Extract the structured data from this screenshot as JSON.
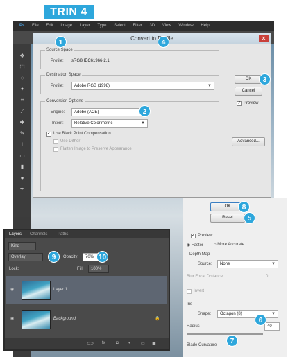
{
  "step_label": "TRIN 4",
  "badges": [
    "1",
    "2",
    "3",
    "4",
    "5",
    "6",
    "7",
    "8",
    "9",
    "10"
  ],
  "app": {
    "logo": "Ps",
    "menu": [
      "File",
      "Edit",
      "Image",
      "Layer",
      "Type",
      "Select",
      "Filter",
      "3D",
      "View",
      "Window",
      "Help"
    ]
  },
  "dialog": {
    "title": "Convert to Profile",
    "source_group": "Source Space",
    "source_label": "Profile:",
    "source_value": "sRGB IEC61966-2.1",
    "dest_group": "Destination Space",
    "dest_label": "Profile:",
    "dest_value": "Adobe RGB (1998)",
    "conv_group": "Conversion Options",
    "engine_label": "Engine:",
    "engine_value": "Adobe (ACE)",
    "intent_label": "Intent:",
    "intent_value": "Relative Colorimetric",
    "use_bpc": "Use Black Point Compensation",
    "use_dither": "Use Dither",
    "flatten": "Flatten Image to Preserve Appearance",
    "ok": "OK",
    "cancel": "Cancel",
    "preview": "Preview",
    "advanced": "Advanced..."
  },
  "blur_panel": {
    "ok": "OK",
    "reset": "Reset",
    "preview": "Preview",
    "faster": "Faster",
    "more_accurate": "More Accurate",
    "depth_map": "Depth Map",
    "source_label": "Source:",
    "source_value": "None",
    "blur_focal": "Blur Focal Distance",
    "blur_focal_value": "0",
    "invert": "Invert",
    "iris": "Iris",
    "shape_label": "Shape:",
    "shape_value": "Octagon (8)",
    "radius_label": "Radius",
    "radius_value": "40",
    "blade_curv": "Blade Curvature"
  },
  "layers_panel": {
    "tabs": [
      "Layers",
      "Channels",
      "Paths"
    ],
    "kind": "Kind",
    "blend": "Overlay",
    "opacity_label": "Opacity:",
    "opacity_value": "70%",
    "lock_label": "Lock:",
    "fill_label": "Fill:",
    "fill_value": "100%",
    "layers": [
      {
        "name": "Layer 1"
      },
      {
        "name": "Background"
      }
    ]
  }
}
